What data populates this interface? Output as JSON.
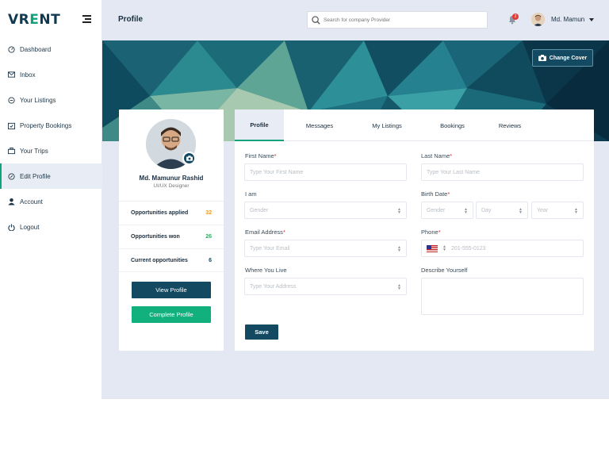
{
  "app": {
    "logo_main": "VR",
    "logo_accent": "E",
    "logo_tail": "NT"
  },
  "sidebar": {
    "items": [
      {
        "label": "Dashboard",
        "icon": "dashboard-icon"
      },
      {
        "label": "Inbox",
        "icon": "inbox-icon"
      },
      {
        "label": "Your Listings",
        "icon": "listings-icon"
      },
      {
        "label": "Property Bookings",
        "icon": "bookings-icon"
      },
      {
        "label": "Your Trips",
        "icon": "trips-icon"
      },
      {
        "label": "Edit Profile",
        "icon": "edit-profile-icon",
        "active": true
      },
      {
        "label": "Account",
        "icon": "account-icon"
      },
      {
        "label": "Logout",
        "icon": "logout-icon"
      }
    ]
  },
  "header": {
    "title": "Profile",
    "search_placeholder": "Search for company Provider",
    "notification_count": "2",
    "user_name": "Md. Mamun"
  },
  "banner": {
    "change_cover_label": "Change Cover"
  },
  "profile": {
    "name": "Md. Mamunur Rashid",
    "role": "UI/UX Designer",
    "stats": [
      {
        "label": "Opportunities applied",
        "value": "32",
        "color": "#f39c12"
      },
      {
        "label": "Opportunities won",
        "value": "26",
        "color": "#27ae60"
      },
      {
        "label": "Current opportunities",
        "value": "6",
        "color": "#134a61"
      }
    ],
    "view_button": "View Profile",
    "complete_button": "Complete Profile"
  },
  "tabs": [
    {
      "label": "Profile",
      "active": true
    },
    {
      "label": "Messages"
    },
    {
      "label": "My Listings"
    },
    {
      "label": "Bookings"
    },
    {
      "label": "Reviews"
    }
  ],
  "form": {
    "first_name": {
      "label": "First Name",
      "required": "*",
      "placeholder": "Type Your First Name"
    },
    "last_name": {
      "label": "Last Name",
      "required": "*",
      "placeholder": "Type Your Last Name"
    },
    "i_am": {
      "label": "I am",
      "placeholder": "Gender"
    },
    "birth_date": {
      "label": "Birth Date",
      "required": "*",
      "gender": "Gender",
      "day": "Day",
      "year": "Year"
    },
    "email": {
      "label": "Email Address",
      "required": "*",
      "placeholder": "Type Your Email"
    },
    "phone": {
      "label": "Phone",
      "required": "*",
      "placeholder": "201-555-0123"
    },
    "where_live": {
      "label": "Where You Live",
      "placeholder": "Type Your Address"
    },
    "describe": {
      "label": "Describe Yourself"
    },
    "save_label": "Save"
  },
  "colors": {
    "primary": "#134a61",
    "accent": "#12a37d",
    "background": "#e3e8f2"
  }
}
